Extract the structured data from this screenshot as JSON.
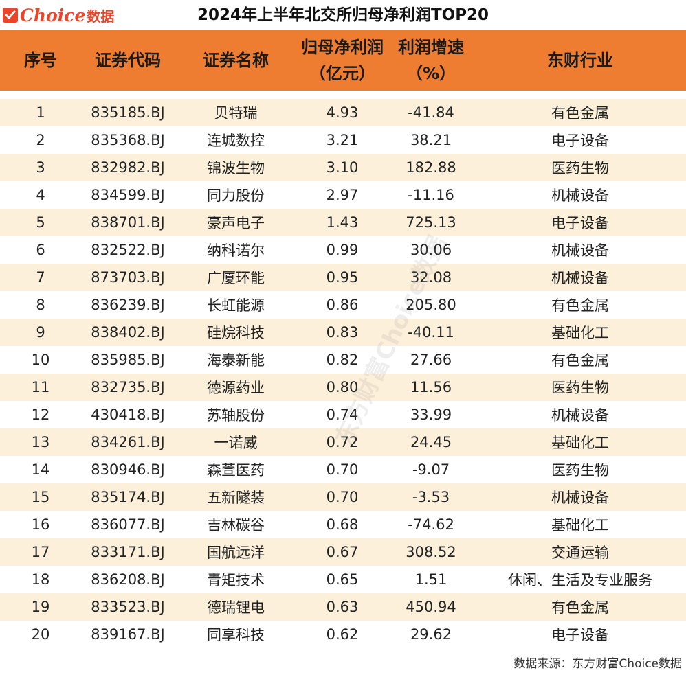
{
  "logo": {
    "brand": "Choice",
    "brand_cn": "数据"
  },
  "title": "2024年上半年北交所归母净利润TOP20",
  "headers": [
    {
      "line1": "序号",
      "line2": ""
    },
    {
      "line1": "证券代码",
      "line2": ""
    },
    {
      "line1": "证券名称",
      "line2": ""
    },
    {
      "line1": "归母净利润",
      "line2": "（亿元）"
    },
    {
      "line1": "利润增速",
      "line2": "（%）"
    },
    {
      "line1": "东财行业",
      "line2": ""
    }
  ],
  "rows": [
    [
      "1",
      "835185.BJ",
      "贝特瑞",
      "4.93",
      "-41.84",
      "有色金属"
    ],
    [
      "2",
      "835368.BJ",
      "连城数控",
      "3.21",
      "38.21",
      "电子设备"
    ],
    [
      "3",
      "832982.BJ",
      "锦波生物",
      "3.10",
      "182.88",
      "医药生物"
    ],
    [
      "4",
      "834599.BJ",
      "同力股份",
      "2.97",
      "-11.16",
      "机械设备"
    ],
    [
      "5",
      "838701.BJ",
      "豪声电子",
      "1.43",
      "725.13",
      "电子设备"
    ],
    [
      "6",
      "832522.BJ",
      "纳科诺尔",
      "0.99",
      "30.06",
      "机械设备"
    ],
    [
      "7",
      "873703.BJ",
      "广厦环能",
      "0.95",
      "32.08",
      "机械设备"
    ],
    [
      "8",
      "836239.BJ",
      "长虹能源",
      "0.86",
      "205.80",
      "有色金属"
    ],
    [
      "9",
      "838402.BJ",
      "硅烷科技",
      "0.83",
      "-40.11",
      "基础化工"
    ],
    [
      "10",
      "835985.BJ",
      "海泰新能",
      "0.82",
      "27.66",
      "有色金属"
    ],
    [
      "11",
      "832735.BJ",
      "德源药业",
      "0.80",
      "11.56",
      "医药生物"
    ],
    [
      "12",
      "430418.BJ",
      "苏轴股份",
      "0.74",
      "33.99",
      "机械设备"
    ],
    [
      "13",
      "834261.BJ",
      "一诺威",
      "0.72",
      "24.45",
      "基础化工"
    ],
    [
      "14",
      "830946.BJ",
      "森萱医药",
      "0.70",
      "-9.07",
      "医药生物"
    ],
    [
      "15",
      "835174.BJ",
      "五新隧装",
      "0.70",
      "-3.53",
      "机械设备"
    ],
    [
      "16",
      "836077.BJ",
      "吉林碳谷",
      "0.68",
      "-74.62",
      "基础化工"
    ],
    [
      "17",
      "833171.BJ",
      "国航远洋",
      "0.67",
      "308.52",
      "交通运输"
    ],
    [
      "18",
      "836208.BJ",
      "青矩技术",
      "0.65",
      "1.51",
      "休闲、生活及专业服务"
    ],
    [
      "19",
      "833523.BJ",
      "德瑞锂电",
      "0.63",
      "450.94",
      "有色金属"
    ],
    [
      "20",
      "839167.BJ",
      "同享科技",
      "0.62",
      "29.62",
      "电子设备"
    ]
  ],
  "footer": "数据来源：东方财富Choice数据",
  "watermark": "东方财富Choice数据",
  "colors": {
    "header_bg": "#ee7d32",
    "stripe": "#fdf0da",
    "brand": "#e8452a"
  }
}
